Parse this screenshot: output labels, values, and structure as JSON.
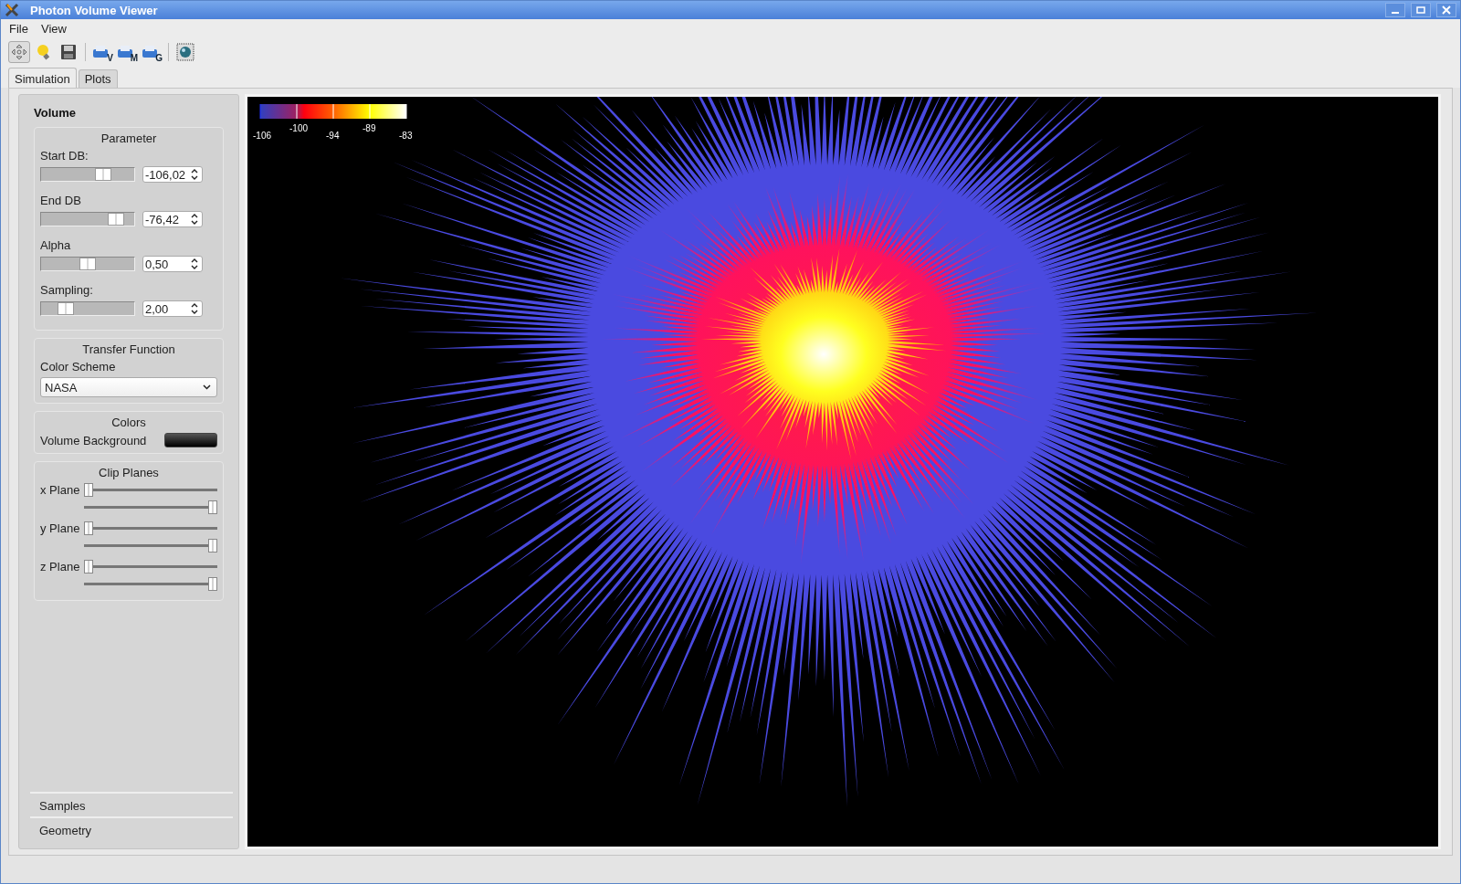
{
  "window": {
    "title": "Photon Volume Viewer"
  },
  "menu": [
    "File",
    "View"
  ],
  "toolbar": [
    {
      "kind": "move",
      "pressed": true
    },
    {
      "kind": "bulb",
      "pressed": false
    },
    {
      "kind": "save",
      "pressed": false
    },
    {
      "kind": "sep"
    },
    {
      "kind": "print",
      "letter": "V",
      "pressed": false
    },
    {
      "kind": "print",
      "letter": "M",
      "pressed": false
    },
    {
      "kind": "print",
      "letter": "G",
      "pressed": false
    },
    {
      "kind": "sep"
    },
    {
      "kind": "sphere",
      "pressed": false
    }
  ],
  "tabs": [
    {
      "label": "Simulation",
      "selected": true
    },
    {
      "label": "Plots",
      "selected": false
    }
  ],
  "toolbox": [
    {
      "label": "Volume",
      "expanded": true
    },
    {
      "label": "Samples",
      "expanded": false
    },
    {
      "label": "Geometry",
      "expanded": false
    }
  ],
  "parameter": {
    "title": "Parameter",
    "rows": [
      {
        "label": "Start DB:",
        "level": 0.7,
        "value": "-106,02"
      },
      {
        "label": "End DB",
        "level": 0.87,
        "value": "-76,42"
      },
      {
        "label": "Alpha",
        "level": 0.5,
        "value": "0,50"
      },
      {
        "label": "Sampling:",
        "level": 0.22,
        "value": "2,00"
      }
    ]
  },
  "transfer": {
    "title": "Transfer Function",
    "label": "Color Scheme",
    "value": "NASA"
  },
  "colors": {
    "title": "Colors",
    "label": "Volume Background"
  },
  "clip_planes": {
    "title": "Clip Planes",
    "planes": [
      {
        "label": "x Plane",
        "sliders": [
          {
            "level": 0
          },
          {
            "level": 1
          }
        ]
      },
      {
        "label": "y Plane",
        "sliders": [
          {
            "level": 0
          },
          {
            "level": 1
          }
        ]
      },
      {
        "label": "z Plane",
        "sliders": [
          {
            "level": 0
          },
          {
            "level": 1
          }
        ]
      }
    ]
  },
  "legend": {
    "labels": [
      "-106",
      "-100",
      "-94",
      "-89",
      "-83"
    ]
  }
}
